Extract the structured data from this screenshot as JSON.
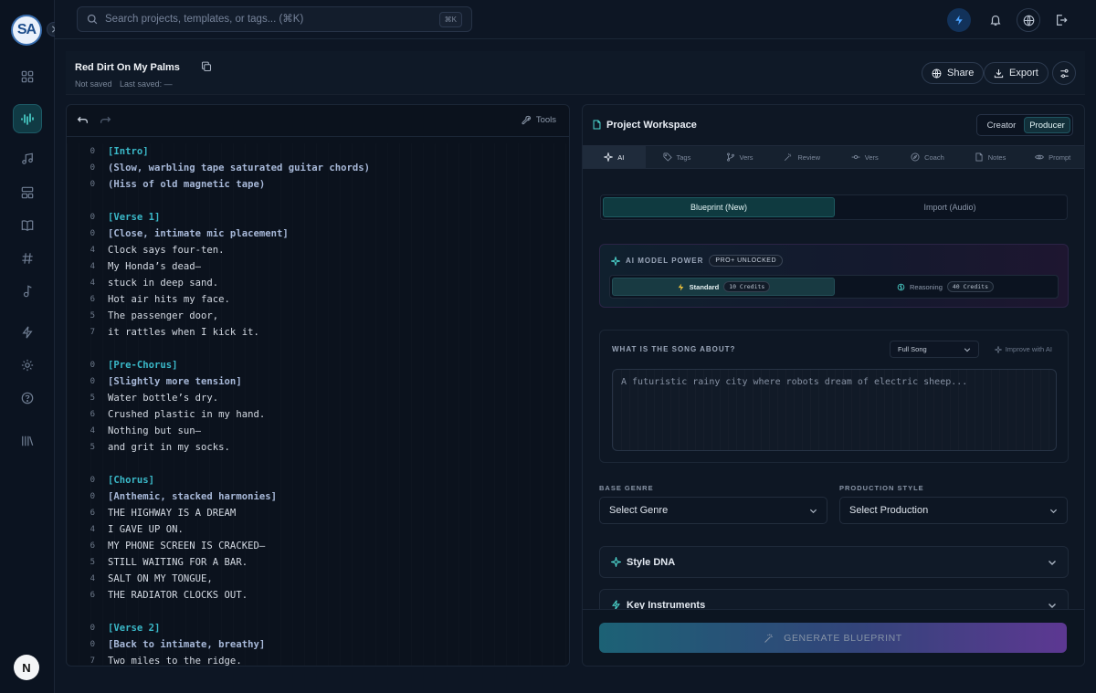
{
  "logo": {
    "text": "SA"
  },
  "search": {
    "placeholder": "Search projects, templates, or tags... (⌘K)",
    "shortcut": "⌘K"
  },
  "sidebar": {
    "icons": [
      "dashboard-icon",
      "waveform-icon",
      "music-note-icon",
      "layout-icon",
      "book-icon",
      "hash-icon",
      "music-single-icon",
      "bolt-icon",
      "settings-icon",
      "help-icon",
      "library-icon"
    ],
    "active": "waveform-icon",
    "avatar": "N"
  },
  "song": {
    "title": "Red Dirt On My Palms",
    "status": "Not saved",
    "last_saved": "Last saved: —"
  },
  "header_actions": {
    "share": "Share",
    "export": "Export"
  },
  "editor": {
    "tools_label": "Tools",
    "lines": [
      {
        "n": "0",
        "text": "[Intro]",
        "kind": "section"
      },
      {
        "n": "0",
        "text": "(Slow, warbling tape saturated guitar chords)",
        "kind": "cue"
      },
      {
        "n": "0",
        "text": "(Hiss of old magnetic tape)",
        "kind": "cue"
      },
      {
        "n": "",
        "text": "",
        "kind": "blank"
      },
      {
        "n": "0",
        "text": "[Verse 1]",
        "kind": "section"
      },
      {
        "n": "0",
        "text": "[Close, intimate mic placement]",
        "kind": "cue"
      },
      {
        "n": "4",
        "text": "Clock says four-ten.",
        "kind": "lyric"
      },
      {
        "n": "4",
        "text": "My Honda’s dead—",
        "kind": "lyric"
      },
      {
        "n": "4",
        "text": "stuck in deep sand.",
        "kind": "lyric"
      },
      {
        "n": "6",
        "text": "Hot air hits my face.",
        "kind": "lyric"
      },
      {
        "n": "5",
        "text": "The passenger door,",
        "kind": "lyric"
      },
      {
        "n": "7",
        "text": "it rattles when I kick it.",
        "kind": "lyric"
      },
      {
        "n": "",
        "text": "",
        "kind": "blank"
      },
      {
        "n": "0",
        "text": "[Pre-Chorus]",
        "kind": "section"
      },
      {
        "n": "0",
        "text": "[Slightly more tension]",
        "kind": "cue"
      },
      {
        "n": "5",
        "text": "Water bottle’s dry.",
        "kind": "lyric"
      },
      {
        "n": "6",
        "text": "Crushed plastic in my hand.",
        "kind": "lyric"
      },
      {
        "n": "4",
        "text": "Nothing but sun—",
        "kind": "lyric"
      },
      {
        "n": "5",
        "text": "and grit in my socks.",
        "kind": "lyric"
      },
      {
        "n": "",
        "text": "",
        "kind": "blank"
      },
      {
        "n": "0",
        "text": "[Chorus]",
        "kind": "section"
      },
      {
        "n": "0",
        "text": "[Anthemic, stacked harmonies]",
        "kind": "cue"
      },
      {
        "n": "6",
        "text": "THE HIGHWAY IS A DREAM",
        "kind": "lyric"
      },
      {
        "n": "4",
        "text": "I GAVE UP ON.",
        "kind": "lyric"
      },
      {
        "n": "6",
        "text": "MY PHONE SCREEN IS CRACKED—",
        "kind": "lyric"
      },
      {
        "n": "5",
        "text": "STILL WAITING FOR A BAR.",
        "kind": "lyric"
      },
      {
        "n": "4",
        "text": "SALT ON MY TONGUE,",
        "kind": "lyric"
      },
      {
        "n": "6",
        "text": "THE RADIATOR CLOCKS OUT.",
        "kind": "lyric"
      },
      {
        "n": "",
        "text": "",
        "kind": "blank"
      },
      {
        "n": "0",
        "text": "[Verse 2]",
        "kind": "section"
      },
      {
        "n": "0",
        "text": "[Back to intimate, breathy]",
        "kind": "cue"
      },
      {
        "n": "7",
        "text": "Two miles to the ridge.",
        "kind": "lyric"
      }
    ]
  },
  "workspace": {
    "title": "Project Workspace",
    "modes": [
      "Creator",
      "Producer"
    ],
    "active_mode": "Producer",
    "tabs": [
      {
        "label": "AI",
        "icon": "sparkle-icon"
      },
      {
        "label": "Tags",
        "icon": "tag-icon"
      },
      {
        "label": "Vers",
        "icon": "branch-icon"
      },
      {
        "label": "Review",
        "icon": "wand-icon"
      },
      {
        "label": "Vers",
        "icon": "commit-icon"
      },
      {
        "label": "Coach",
        "icon": "compass-icon"
      },
      {
        "label": "Notes",
        "icon": "note-icon"
      },
      {
        "label": "Prompt",
        "icon": "eye-icon"
      }
    ],
    "active_tab": "AI",
    "blueprint_options": [
      "Blueprint (New)",
      "Import (Audio)"
    ],
    "power": {
      "label": "AI MODEL POWER",
      "badge": "PRO+ UNLOCKED",
      "standard": "Standard",
      "standard_credits": "10 Credits",
      "reasoning": "Reasoning",
      "reasoning_credits": "40 Credits"
    },
    "about": {
      "label": "WHAT IS THE SONG ABOUT?",
      "scope": "Full Song",
      "improve": "Improve with AI",
      "placeholder": "A futuristic rainy city where robots dream of electric sheep..."
    },
    "genre_label": "BASE GENRE",
    "genre_value": "Select Genre",
    "production_label": "PRODUCTION STYLE",
    "production_value": "Select Production",
    "sections": [
      "Style DNA",
      "Key Instruments"
    ],
    "generate": "GENERATE BLUEPRINT"
  }
}
